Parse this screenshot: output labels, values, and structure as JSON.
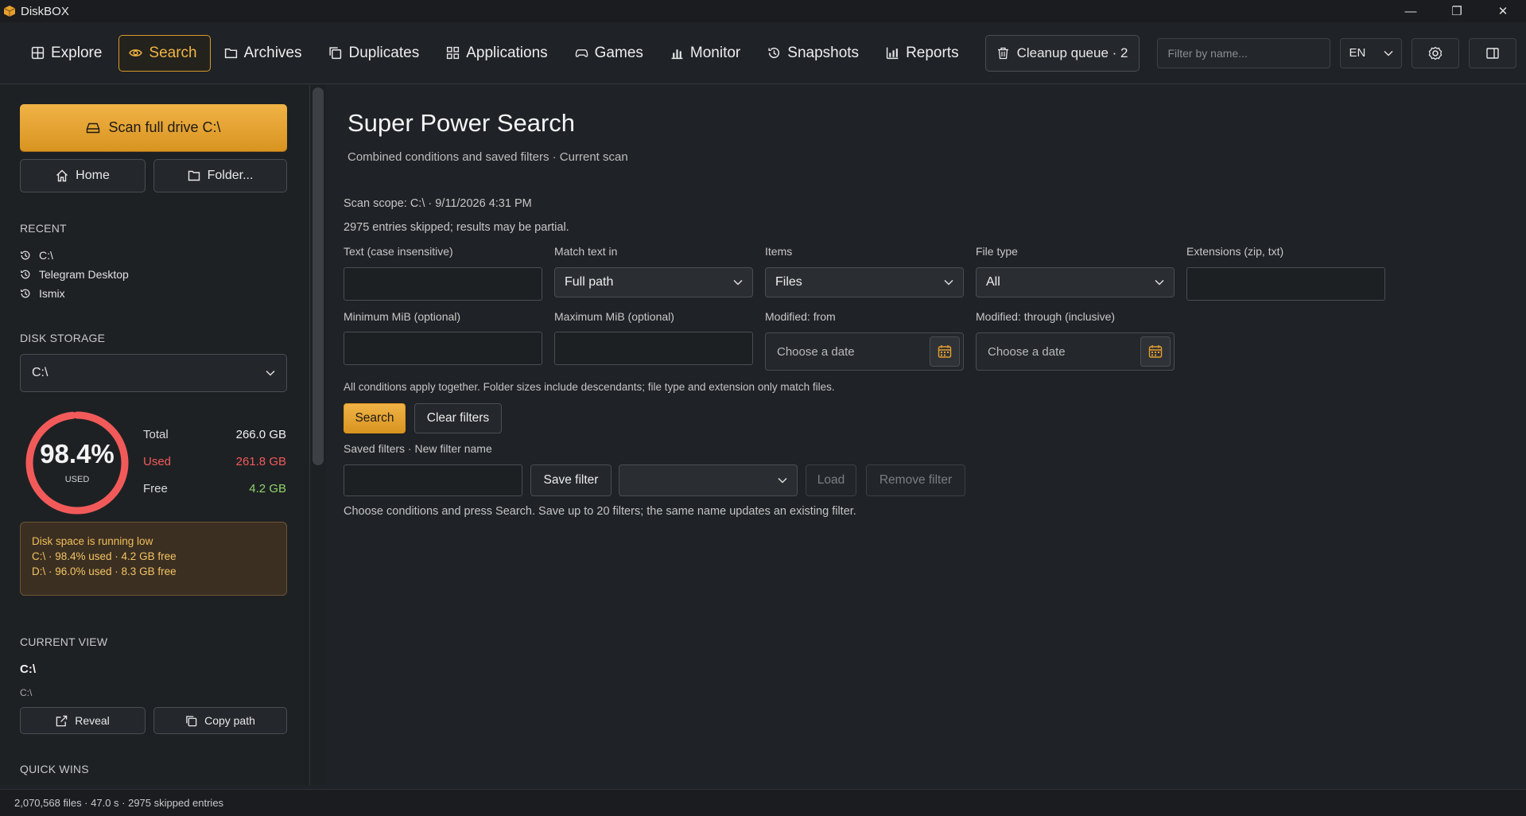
{
  "app": {
    "title": "DiskBOX"
  },
  "window_controls": {
    "minimize": "—",
    "maximize": "❐",
    "close": "✕"
  },
  "nav": {
    "items": [
      {
        "label": "Explore",
        "icon": "grid-icon",
        "active": false
      },
      {
        "label": "Search",
        "icon": "eye-icon",
        "active": true
      },
      {
        "label": "Archives",
        "icon": "folder-icon",
        "active": false
      },
      {
        "label": "Duplicates",
        "icon": "copy-icon",
        "active": false
      },
      {
        "label": "Applications",
        "icon": "apps-icon",
        "active": false
      },
      {
        "label": "Games",
        "icon": "gamepad-icon",
        "active": false
      },
      {
        "label": "Monitor",
        "icon": "bar-chart-icon",
        "active": false
      },
      {
        "label": "Snapshots",
        "icon": "history-icon",
        "active": false
      },
      {
        "label": "Reports",
        "icon": "report-icon",
        "active": false
      }
    ],
    "cleanup_label": "Cleanup queue · 2",
    "filter_placeholder": "Filter by name...",
    "language": "EN"
  },
  "sidebar": {
    "scan_button": "Scan full drive  C:\\",
    "home_button": "Home",
    "folder_button": "Folder...",
    "recent_title": "RECENT",
    "recent": [
      "C:\\",
      "Telegram Desktop",
      "Ismix"
    ],
    "disk_title": "DISK STORAGE",
    "disk_selected": "C:\\",
    "gauge": {
      "percent": "98.4%",
      "label": "USED",
      "fraction": 0.984
    },
    "stats": {
      "total_label": "Total",
      "total_value": "266.0 GB",
      "used_label": "Used",
      "used_value": "261.8 GB",
      "free_label": "Free",
      "free_value": "4.2 GB"
    },
    "warning": {
      "title": "Disk space is running low",
      "line1": "C:\\ · 98.4% used · 4.2 GB free",
      "line2": "D:\\ · 96.0% used · 8.3 GB free"
    },
    "current_view_title": "CURRENT VIEW",
    "current_path": "C:\\",
    "current_sub": "C:\\",
    "reveal_button": "Reveal",
    "copy_path_button": "Copy path",
    "quick_wins_title": "QUICK WINS"
  },
  "main": {
    "title": "Super Power Search",
    "subtitle": "Combined conditions and saved filters · Current scan",
    "scope": "Scan scope: C:\\ · 9/11/2026 4:31 PM",
    "skipped": "2975 entries skipped; results may be partial.",
    "fields": {
      "text_label": "Text (case insensitive)",
      "match_label": "Match text in",
      "match_value": "Full path",
      "items_label": "Items",
      "items_value": "Files",
      "filetype_label": "File type",
      "filetype_value": "All",
      "ext_label": "Extensions (zip, txt)",
      "min_label": "Minimum MiB (optional)",
      "max_label": "Maximum MiB (optional)",
      "from_label": "Modified: from",
      "from_placeholder": "Choose a date",
      "through_label": "Modified: through (inclusive)",
      "through_placeholder": "Choose a date"
    },
    "conditions_note": "All conditions apply together. Folder sizes include descendants; file type and extension only match files.",
    "search_button": "Search",
    "clear_button": "Clear filters",
    "saved_label": "Saved filters · New filter name",
    "save_button": "Save filter",
    "load_button": "Load",
    "remove_button": "Remove filter",
    "hint": "Choose conditions and press Search. Save up to 20 filters; the same name updates an existing filter."
  },
  "status": {
    "text": "2,070,568 files · 47.0 s · 2975 skipped entries"
  },
  "colors": {
    "accent": "#f0b347",
    "used": "#f25a5a",
    "free": "#8fd46a",
    "warning_bg": "#3b2f22"
  }
}
